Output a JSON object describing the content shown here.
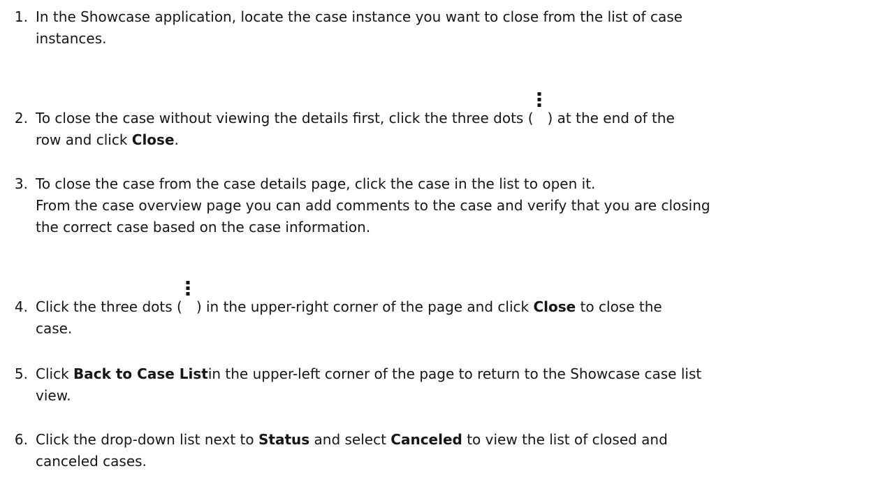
{
  "steps": [
    {
      "number": "1.",
      "lines": [
        "In the Showcase application, locate the case instance you want to close from the list of case",
        "instances."
      ]
    },
    {
      "number": "2.",
      "line1_before_icon": "To close the case without viewing the details first, click the three dots (",
      "line1_after_icon": ") at the end of the",
      "line2_before": "row and click ",
      "line2_bold": "Close",
      "line2_after": "."
    },
    {
      "number": "3.",
      "lines": [
        "To close the case from the case details page, click the case in the list to open it.",
        "From the case overview page you can add comments to the case and verify that you are closing",
        "the correct case based on the case information."
      ]
    },
    {
      "number": "4.",
      "line1_before_icon": "Click the three dots (",
      "line1_after_icon": ") in the upper-right corner of the page and click ",
      "line1_bold": "Close",
      "line1_after_bold": " to close the",
      "line2": "case."
    },
    {
      "number": "5.",
      "line1_before": "Click ",
      "line1_bold": "Back to Case List",
      "line1_after": "in the upper-left corner of the page to return to the Showcase case list",
      "line2": "view."
    },
    {
      "number": "6.",
      "line1_before": "Click the drop-down list next to ",
      "line1_bold1": "Status",
      "line1_middle": " and select ",
      "line1_bold2": "Canceled",
      "line1_after": " to view the list of closed and",
      "line2": "canceled cases."
    }
  ],
  "icons": {
    "kebab": "kebab-vertical-icon"
  }
}
